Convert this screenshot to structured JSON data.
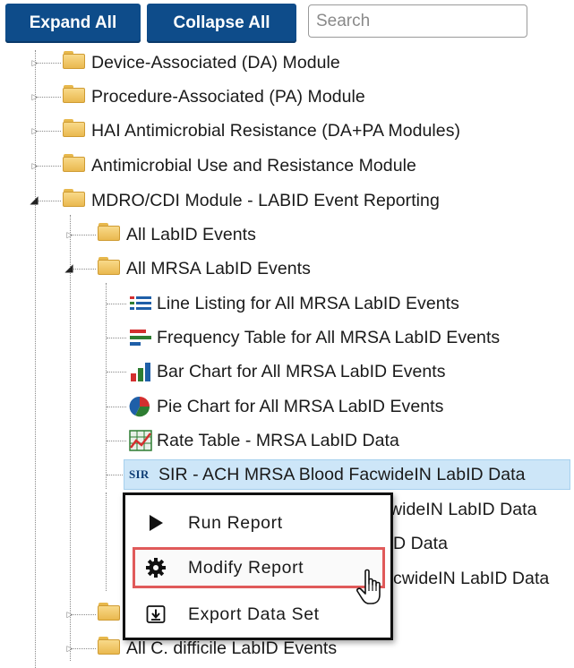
{
  "toolbar": {
    "expand_label": "Expand All",
    "collapse_label": "Collapse All",
    "search_placeholder": "Search",
    "search_value": ""
  },
  "tree": {
    "modules": [
      {
        "label": "Device-Associated (DA) Module",
        "expanded": false
      },
      {
        "label": "Procedure-Associated (PA) Module",
        "expanded": false
      },
      {
        "label": "HAI Antimicrobial Resistance (DA+PA Modules)",
        "expanded": false
      },
      {
        "label": "Antimicrobial Use and Resistance Module",
        "expanded": false
      },
      {
        "label": "MDRO/CDI Module - LABID Event Reporting",
        "expanded": true
      }
    ],
    "subfolders": [
      {
        "label": "All LabID Events",
        "expanded": false
      },
      {
        "label": "All MRSA LabID Events",
        "expanded": true
      }
    ],
    "reports": [
      {
        "label": "Line Listing for All MRSA LabID Events",
        "icon": "line-listing-icon"
      },
      {
        "label": "Frequency Table for All MRSA LabID Events",
        "icon": "frequency-table-icon"
      },
      {
        "label": "Bar Chart for All MRSA LabID Events",
        "icon": "bar-chart-icon"
      },
      {
        "label": "Pie Chart for All MRSA LabID Events",
        "icon": "pie-chart-icon"
      },
      {
        "label": "Rate Table - MRSA LabID Data",
        "icon": "rate-table-icon"
      },
      {
        "label": "SIR - ACH MRSA Blood FacwideIN LabID Data",
        "icon": "sir-icon",
        "selected": true
      }
    ],
    "sir_badge": "SIR",
    "occluded_fragments": [
      "wideIN LabID Data",
      "D Data",
      "cwideIN LabID Data"
    ],
    "bottom_folder_label": "All C. difficile LabID Events"
  },
  "context_menu": {
    "items": [
      {
        "label": "Run Report",
        "icon": "play-icon"
      },
      {
        "label": "Modify Report",
        "icon": "gear-icon",
        "highlighted": true
      },
      {
        "label": "Export Data Set",
        "icon": "export-icon"
      }
    ]
  },
  "colors": {
    "button_bg": "#0e4c8a",
    "selection_bg": "#cde6f8",
    "highlight_border": "#e05a5a"
  }
}
